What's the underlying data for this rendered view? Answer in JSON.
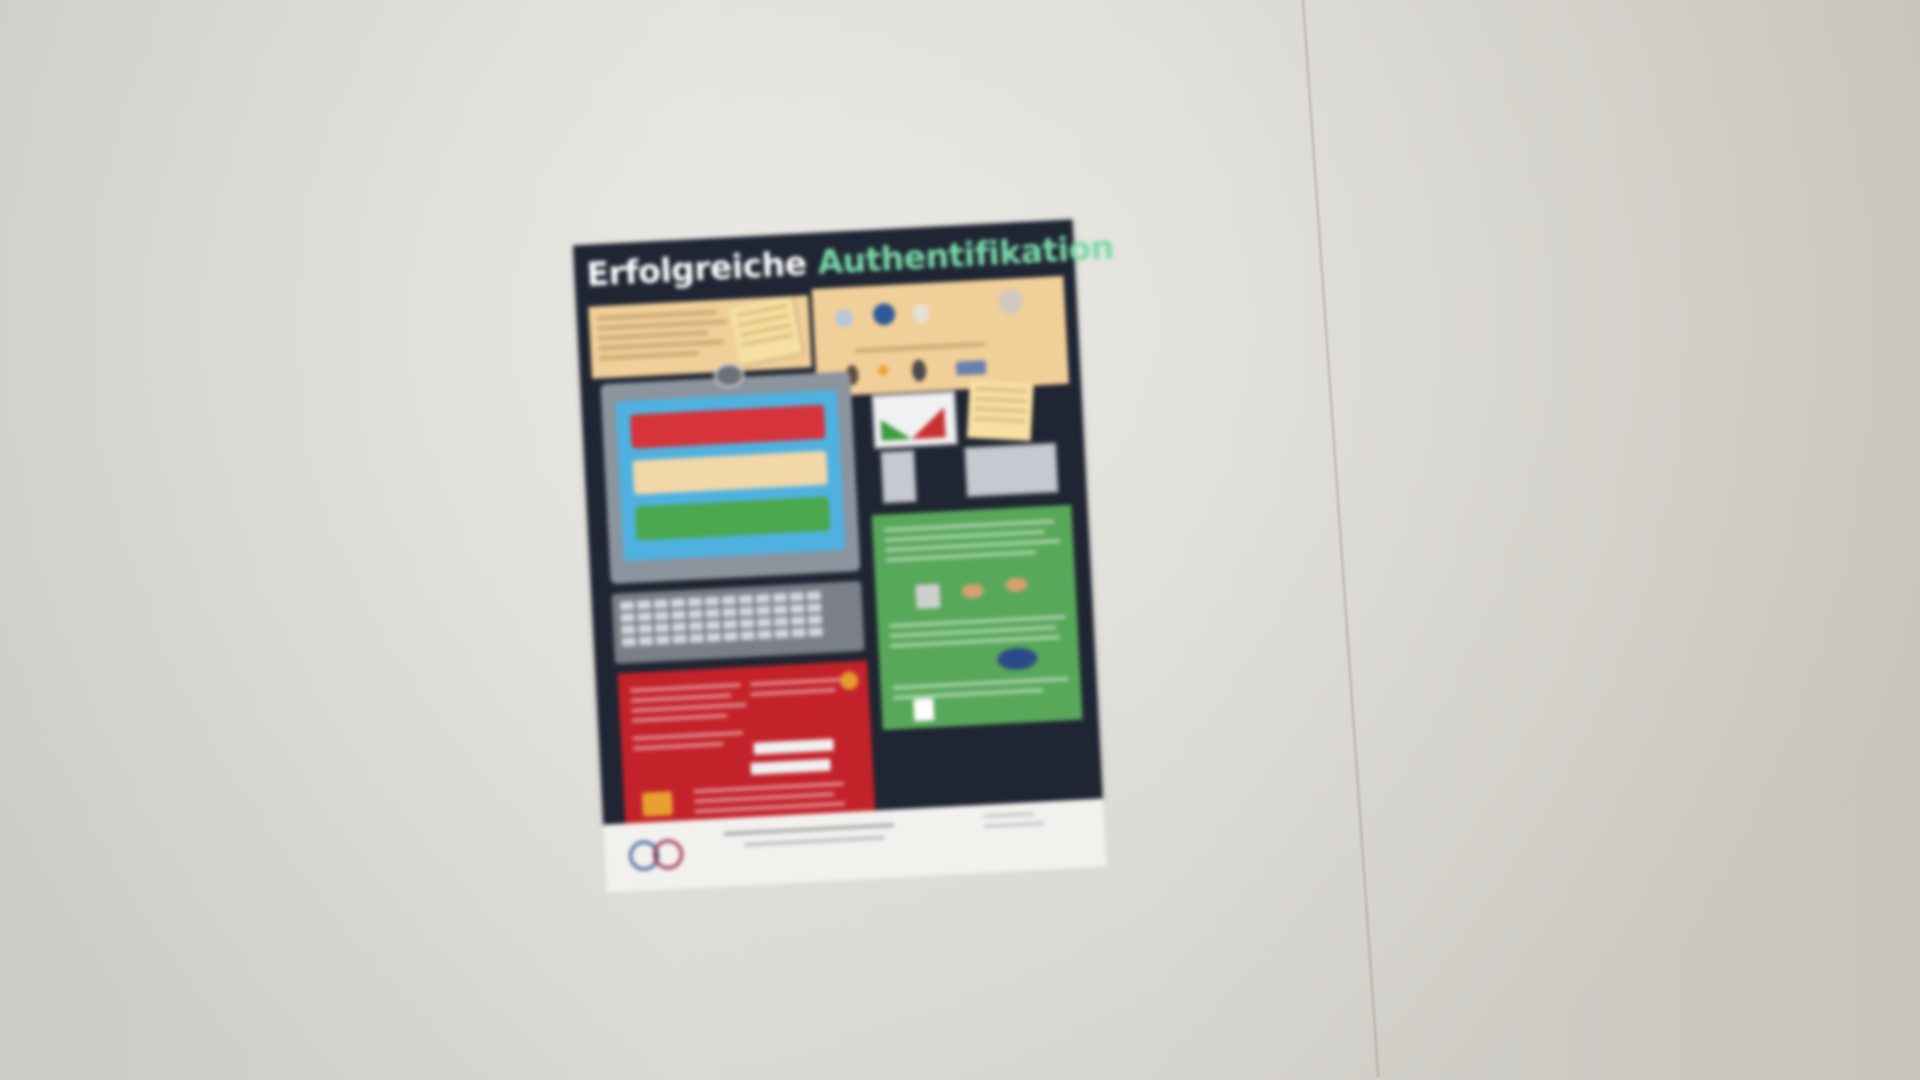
{
  "scene": {
    "description_type": "photo of poster on wall",
    "poster_title_part1": "Erfolgreiche",
    "poster_title_part2": "Authentifikation"
  },
  "colors": {
    "wall": "#e2e0da",
    "poster_background": "#1f2532",
    "title_white": "#ffffff",
    "title_green": "#7ad9a8",
    "tan": "#f1cf98",
    "screen_blue": "#4fb1e0",
    "red_panel": "#c4222a",
    "green_panel": "#58a85a"
  }
}
